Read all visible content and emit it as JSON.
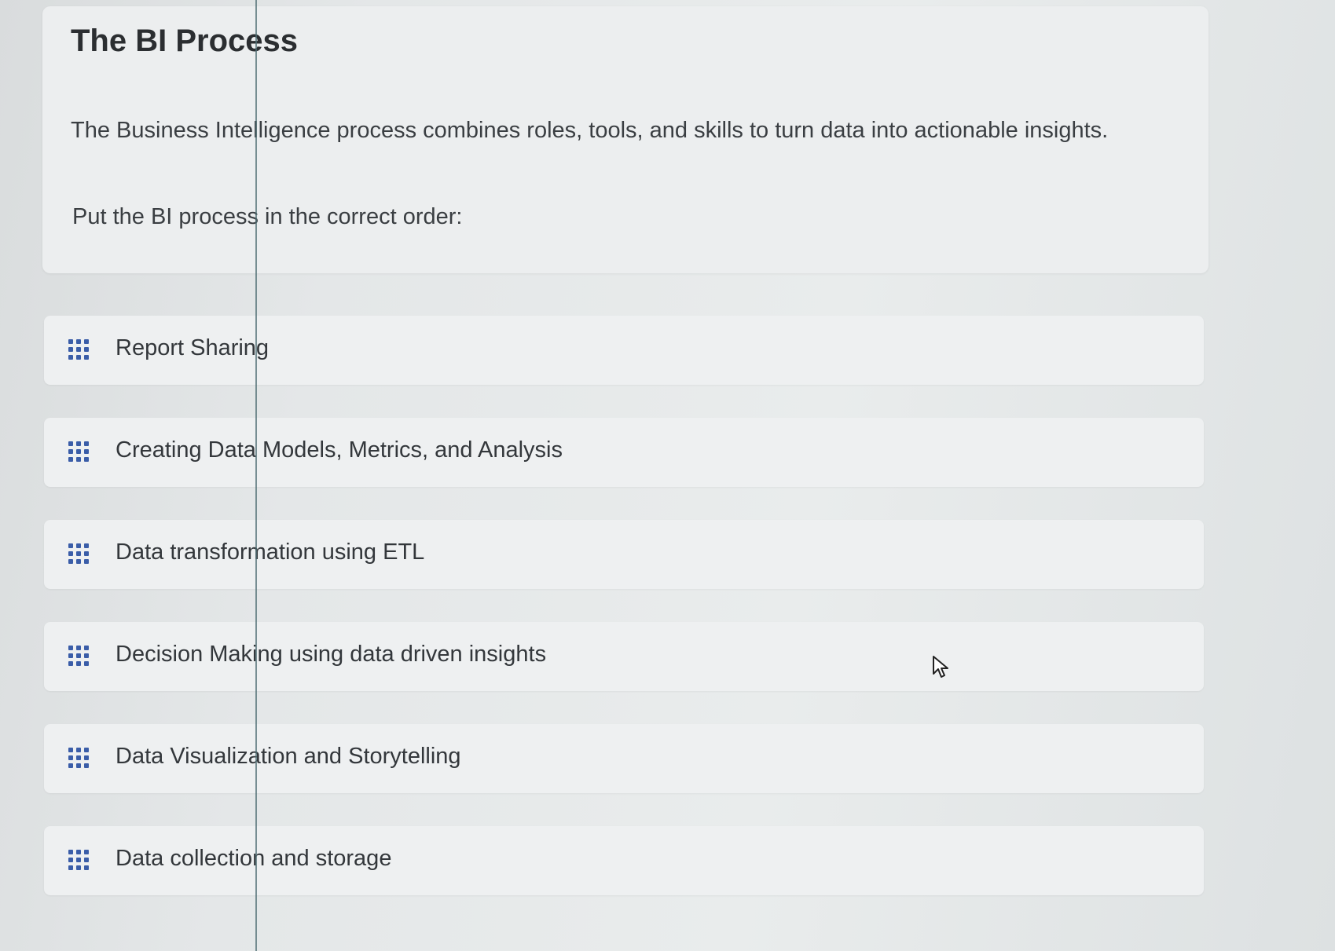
{
  "question": {
    "title": "The BI Process",
    "description": "The Business Intelligence process combines roles, tools, and skills to turn data into actionable insights.",
    "prompt": "Put the BI process in the correct order:"
  },
  "items": [
    {
      "label": "Report Sharing",
      "icon": "drag-handle-icon"
    },
    {
      "label": "Creating Data Models, Metrics, and Analysis",
      "icon": "drag-handle-icon"
    },
    {
      "label": "Data transformation using ETL",
      "icon": "drag-handle-icon"
    },
    {
      "label": "Decision Making using data driven insights",
      "icon": "drag-handle-icon"
    },
    {
      "label": "Data Visualization and Storytelling",
      "icon": "drag-handle-icon"
    },
    {
      "label": "Data collection and storage",
      "icon": "drag-handle-icon"
    }
  ],
  "colors": {
    "handle": "#3a5da8",
    "background": "#e6e9ea",
    "card": "#eceeef"
  }
}
